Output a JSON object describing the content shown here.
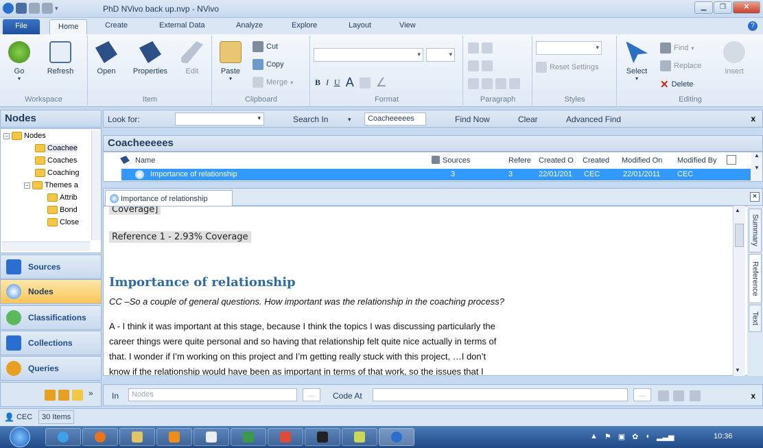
{
  "window": {
    "title": "PhD NVivo back up.nvp - NVivo"
  },
  "ribbon_tabs": [
    "File",
    "Home",
    "Create",
    "External Data",
    "Analyze",
    "Explore",
    "Layout",
    "View"
  ],
  "ribbon": {
    "workspace": {
      "label": "Workspace",
      "go": "Go",
      "refresh": "Refresh"
    },
    "item": {
      "label": "Item",
      "open": "Open",
      "properties": "Properties",
      "edit": "Edit"
    },
    "clipboard": {
      "label": "Clipboard",
      "paste": "Paste",
      "cut": "Cut",
      "copy": "Copy",
      "merge": "Merge"
    },
    "format": {
      "label": "Format",
      "bold": "B",
      "italic": "I",
      "underline": "U"
    },
    "paragraph": {
      "label": "Paragraph"
    },
    "styles": {
      "label": "Styles",
      "reset": "Reset Settings"
    },
    "editing": {
      "label": "Editing",
      "select": "Select",
      "find": "Find",
      "replace": "Replace",
      "delete": "Delete",
      "insert": "Insert"
    }
  },
  "findbar": {
    "look_for": "Look for:",
    "search_in": "Search In",
    "search_value": "Coacheeeees",
    "find_now": "Find Now",
    "clear": "Clear",
    "advanced": "Advanced Find",
    "close": "x"
  },
  "nav": {
    "header": "Nodes",
    "tree": [
      {
        "label": "Nodes",
        "level": 0,
        "expander": "⊟"
      },
      {
        "label": "Coachee",
        "level": 1
      },
      {
        "label": "Coaches",
        "level": 1
      },
      {
        "label": "Coaching",
        "level": 1
      },
      {
        "label": "Themes a",
        "level": 0,
        "expander": "⊟"
      },
      {
        "label": "Attrib",
        "level": 2
      },
      {
        "label": "Bond",
        "level": 2
      },
      {
        "label": "Close",
        "level": 2
      }
    ],
    "buttons": [
      "Sources",
      "Nodes",
      "Classifications",
      "Collections",
      "Queries"
    ]
  },
  "list": {
    "title": "Coacheeeees",
    "columns": [
      "Name",
      "Sources",
      "Refere",
      "Created O",
      "Created",
      "Modified On",
      "Modified By"
    ],
    "rows": [
      {
        "name": "Importance of relationship",
        "sources": "3",
        "refs": "3",
        "created_on": "22/01/201",
        "created_by": "CEC",
        "modified_on": "22/01/2011",
        "modified_by": "CEC"
      }
    ]
  },
  "detail": {
    "tab": "Importance of relationship",
    "coverage_top": "Coverage]",
    "reference": "Reference 1 - 2.93% Coverage",
    "heading": "Importance of relationship",
    "question": "CC –So a couple of general questions.  How important was the relationship in the coaching process?",
    "para1": "A - I think it was important at this stage, because I think the topics I was discussing particularly the",
    "para2": "career things were quite personal and so having that relationship felt quite nice actually in terms of",
    "para3": "that.  I wonder if I’m working on this project and I’m getting really stuck with this project, …I don’t",
    "para4": "know if the relationship would have been as important in terms of that work, so the issues that I",
    "side_tabs": [
      "Summary",
      "Reference",
      "Text"
    ]
  },
  "codebar": {
    "in": "In",
    "in_value": "Nodes",
    "code_at": "Code At",
    "dots": "...",
    "close": "x"
  },
  "status": {
    "user": "CEC",
    "items": "30 Items"
  },
  "taskbar": {
    "clock": "10:36"
  }
}
